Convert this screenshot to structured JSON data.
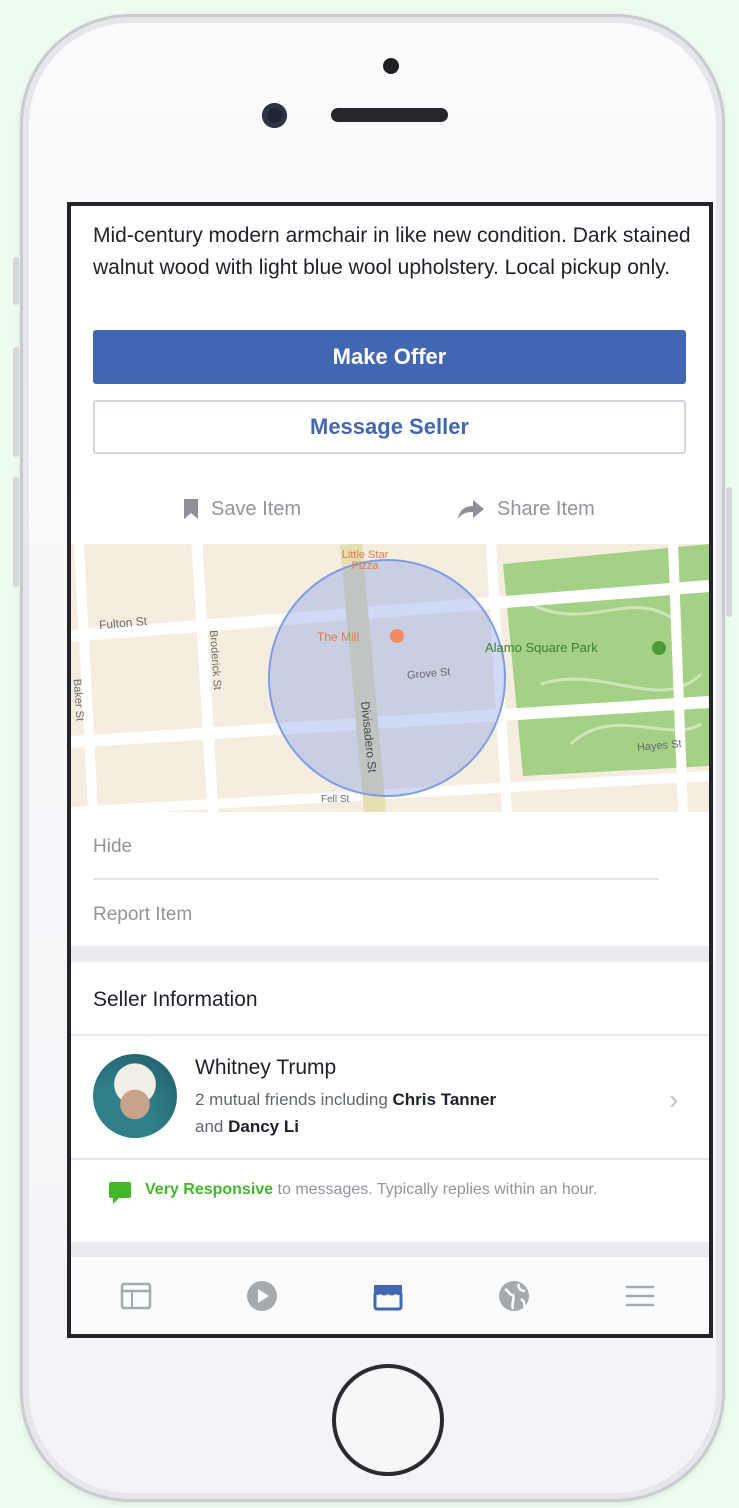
{
  "listing": {
    "description": "Mid-century modern armchair in like new condition. Dark stained walnut wood with light blue wool upholstery. Local pickup only.",
    "make_offer_label": "Make Offer",
    "message_seller_label": "Message Seller",
    "save_item_label": "Save Item",
    "share_item_label": "Share Item"
  },
  "map": {
    "streets": [
      "Fulton St",
      "Broderick St",
      "Grove St",
      "Divisadero St",
      "Hayes St",
      "Baker St",
      "Fell St"
    ],
    "places": [
      "Little Star Pizza",
      "The Mill",
      "Alamo Square Park"
    ],
    "park_name": "Alamo Square Park"
  },
  "options": {
    "hide_label": "Hide",
    "report_label": "Report Item"
  },
  "seller": {
    "section_title": "Seller Information",
    "name": "Whitney Trump",
    "mutual_prefix": "2 mutual friends including",
    "friend_1": "Chris Tanner",
    "conjunction": "and",
    "friend_2": "Dancy Li",
    "responsive_label": "Very Responsive",
    "responsive_text": "to messages. Typically replies within an hour."
  },
  "tabbar": {
    "tabs": [
      "news-feed",
      "watch",
      "marketplace",
      "notifications",
      "menu"
    ],
    "active": "marketplace"
  },
  "colors": {
    "primary": "#4267b2",
    "green": "#42b72a",
    "park": "#9ccc79"
  }
}
